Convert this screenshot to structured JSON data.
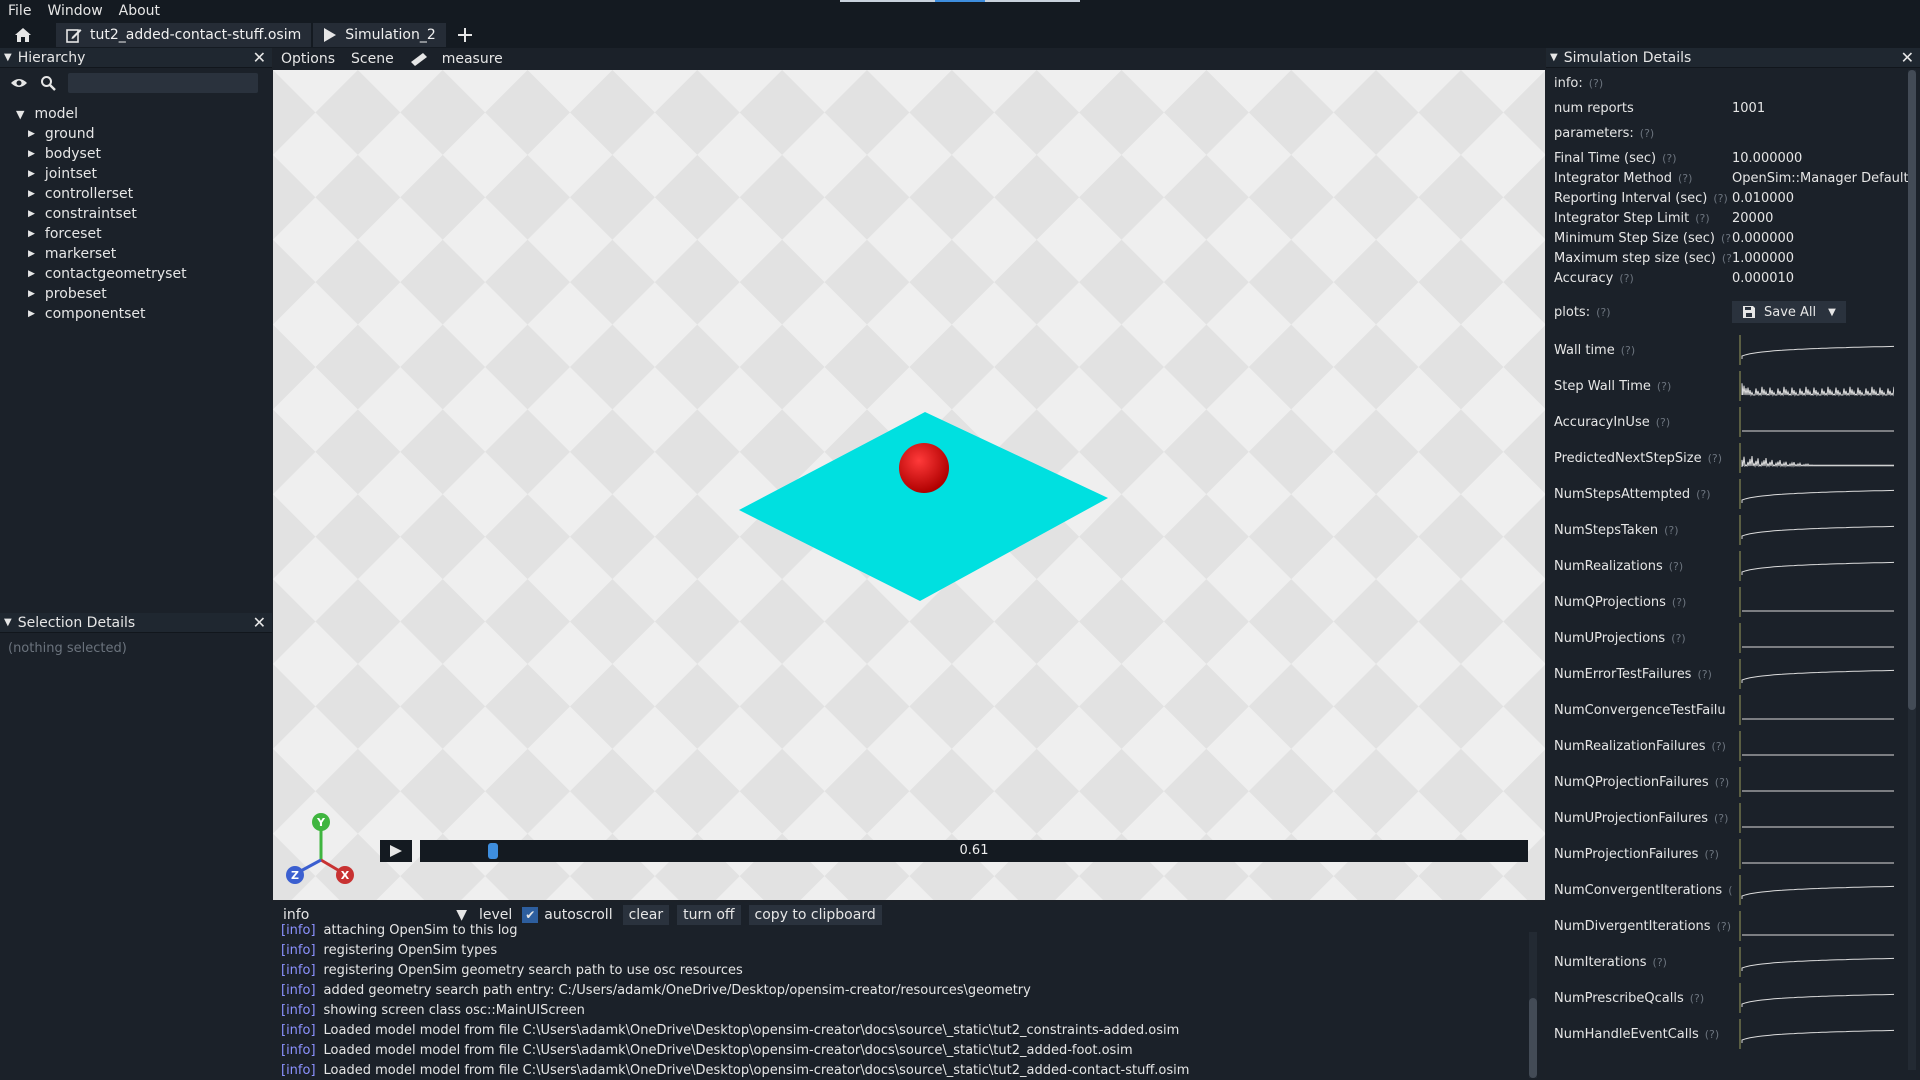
{
  "menubar": {
    "items": [
      "File",
      "Window",
      "About"
    ]
  },
  "tabs": {
    "file_tab": "tut2_added-contact-stuff.osim",
    "sim_tab": "Simulation_2"
  },
  "hierarchy": {
    "title": "Hierarchy",
    "root": "model",
    "children": [
      "ground",
      "bodyset",
      "jointset",
      "controllerset",
      "constraintset",
      "forceset",
      "markerset",
      "contactgeometryset",
      "probeset",
      "componentset"
    ]
  },
  "selection": {
    "title": "Selection Details",
    "empty": "(nothing selected)"
  },
  "viewport": {
    "toolbar": {
      "options": "Options",
      "scene": "Scene",
      "measure": "measure"
    },
    "scrubber_value": "0.61",
    "scrubber_fraction": 0.061,
    "axis_labels": {
      "x": "X",
      "y": "Y",
      "z": "Z"
    },
    "colors": {
      "plane": "#00e0e0",
      "sphere": "#d81414"
    }
  },
  "log": {
    "level": "info",
    "level_label": "level",
    "autoscroll": "autoscroll",
    "clear": "clear",
    "turn_off": "turn off",
    "copy": "copy to clipboard",
    "lines": [
      {
        "lvl": "[info]",
        "msg": "attaching OpenSim to this log"
      },
      {
        "lvl": "[info]",
        "msg": "registering OpenSim types"
      },
      {
        "lvl": "[info]",
        "msg": "registering OpenSim geometry search path to use osc resources"
      },
      {
        "lvl": "[info]",
        "msg": "added geometry search path entry: C:/Users/adamk/OneDrive/Desktop/opensim-creator/resources\\geometry"
      },
      {
        "lvl": "[info]",
        "msg": "showing screen class osc::MainUIScreen"
      },
      {
        "lvl": "[info]",
        "msg": "Loaded model model from file C:\\Users\\adamk\\OneDrive\\Desktop\\opensim-creator\\docs\\source\\_static\\tut2_constraints-added.osim"
      },
      {
        "lvl": "[info]",
        "msg": "Loaded model model from file C:\\Users\\adamk\\OneDrive\\Desktop\\opensim-creator\\docs\\source\\_static\\tut2_added-foot.osim"
      },
      {
        "lvl": "[info]",
        "msg": "Loaded model model from file C:\\Users\\adamk\\OneDrive\\Desktop\\opensim-creator\\docs\\source\\_static\\tut2_added-contact-stuff.osim"
      }
    ]
  },
  "sim": {
    "title": "Simulation Details",
    "info_label": "info:",
    "q": "(?)",
    "num_reports_label": "num reports",
    "num_reports": "1001",
    "parameters_label": "parameters:",
    "params": [
      {
        "k": "Final Time (sec)",
        "v": "10.000000"
      },
      {
        "k": "Integrator Method",
        "v": "OpenSim::Manager Default"
      },
      {
        "k": "Reporting Interval (sec)",
        "v": "0.010000"
      },
      {
        "k": "Integrator Step Limit",
        "v": "20000"
      },
      {
        "k": "Minimum Step Size (sec)",
        "v": "0.000000"
      },
      {
        "k": "Maximum step size (sec)",
        "v": "1.000000"
      },
      {
        "k": "Accuracy",
        "v": "0.000010"
      }
    ],
    "plots_label": "plots:",
    "save_all": "Save All",
    "plots": [
      "Wall time",
      "Step Wall Time",
      "AccuracyInUse",
      "PredictedNextStepSize",
      "NumStepsAttempted",
      "NumStepsTaken",
      "NumRealizations",
      "NumQProjections",
      "NumUProjections",
      "NumErrorTestFailures",
      "NumConvergenceTestFailu",
      "NumRealizationFailures",
      "NumQProjectionFailures",
      "NumUProjectionFailures",
      "NumProjectionFailures",
      "NumConvergentIterations",
      "NumDivergentIterations",
      "NumIterations",
      "NumPrescribeQcalls",
      "NumHandleEventCalls"
    ]
  }
}
